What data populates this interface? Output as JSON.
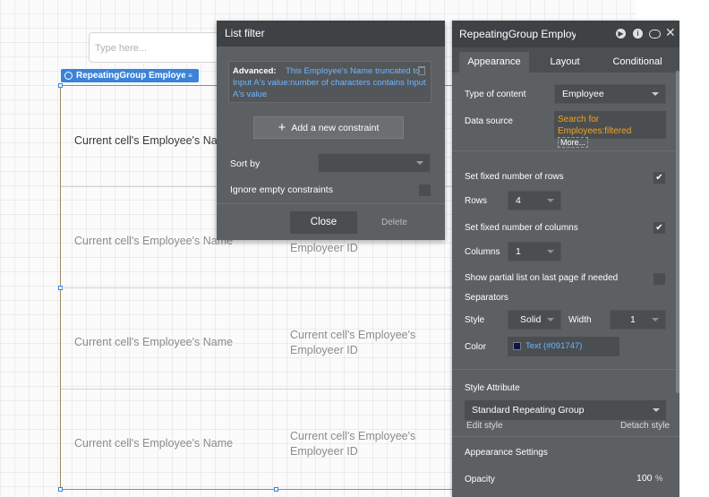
{
  "canvas": {
    "search_placeholder": "Type here...",
    "repeating_group_tag": "RepeatingGroup Employe...",
    "cells": [
      {
        "name": "Current cell's Employee's Name",
        "id": ""
      },
      {
        "name": "Current cell's Employee's Name",
        "id": "Employeer ID"
      },
      {
        "name": "Current cell's Employee's Name",
        "id": "Current cell's Employee's Employeer ID"
      },
      {
        "name": "Current cell's Employee's Name",
        "id": "Current cell's Employee's Employeer ID"
      }
    ]
  },
  "list_filter": {
    "title": "List filter",
    "advanced_label": "Advanced:",
    "advanced_expression": "This Employee's Name truncated to Input A's value:number of characters contains Input A's value",
    "add_constraint_label": "Add a new constraint",
    "sort_by_label": "Sort by",
    "sort_by_value": "",
    "ignore_empty_label": "Ignore empty constraints",
    "close_label": "Close",
    "delete_label": "Delete"
  },
  "property_editor": {
    "title": "RepeatingGroup Employ",
    "header_icons": [
      "play-icon",
      "info-icon",
      "comment-icon",
      "close-icon"
    ],
    "tabs": [
      "Appearance",
      "Layout",
      "Conditional"
    ],
    "active_tab": "Appearance",
    "type_of_content_label": "Type of content",
    "type_of_content_value": "Employee",
    "data_source_label": "Data source",
    "data_source_value": "Search for Employees:filtered",
    "data_source_more": "More...",
    "fixed_rows_label": "Set fixed number of rows",
    "fixed_rows_checked": true,
    "rows_label": "Rows",
    "rows_value": "4",
    "fixed_columns_label": "Set fixed number of columns",
    "fixed_columns_checked": true,
    "columns_label": "Columns",
    "columns_value": "1",
    "partial_list_label": "Show partial list on last page if needed",
    "partial_list_checked": false,
    "separators_label": "Separators",
    "style_label": "Style",
    "style_value": "Solid",
    "width_label": "Width",
    "width_value": "1",
    "color_label": "Color",
    "color_value": "Text (#091747)",
    "color_hex": "#091747",
    "style_attribute_label": "Style Attribute",
    "style_attribute_value": "Standard Repeating Group",
    "edit_style_label": "Edit style",
    "detach_style_label": "Detach style",
    "appearance_settings_label": "Appearance Settings",
    "opacity_label": "Opacity",
    "opacity_value": "100",
    "opacity_unit": "%"
  },
  "colors": {
    "panel_bg": "#5c6063",
    "panel_header": "#3e4245",
    "accent_blue": "#3b83d8",
    "link_blue": "#6cb6ff",
    "dynamic_orange": "#f0a228"
  }
}
